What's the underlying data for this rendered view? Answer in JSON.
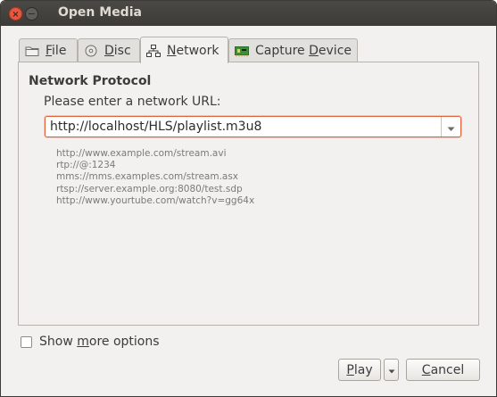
{
  "window": {
    "title": "Open Media"
  },
  "tabs": [
    {
      "label_pre": "",
      "label_ul": "F",
      "label_post": "ile",
      "icon": "folder-icon"
    },
    {
      "label_pre": "",
      "label_ul": "D",
      "label_post": "isc",
      "icon": "disc-icon"
    },
    {
      "label_pre": "",
      "label_ul": "N",
      "label_post": "etwork",
      "icon": "network-icon",
      "active": true
    },
    {
      "label_pre": "Capture ",
      "label_ul": "D",
      "label_post": "evice",
      "icon": "capture-card-icon"
    }
  ],
  "network": {
    "section_title": "Network Protocol",
    "prompt": "Please enter a network URL:",
    "url_value": "http://localhost/HLS/playlist.m3u8",
    "examples": [
      "http://www.example.com/stream.avi",
      "rtp://@:1234",
      "mms://mms.examples.com/stream.asx",
      "rtsp://server.example.org:8080/test.sdp",
      "http://www.yourtube.com/watch?v=gg64x"
    ]
  },
  "options": {
    "more_pre": "Show ",
    "more_ul": "m",
    "more_post": "ore options",
    "checked": false
  },
  "buttons": {
    "play_ul": "P",
    "play_post": "lay",
    "cancel_ul": "C",
    "cancel_post": "ancel"
  },
  "colors": {
    "focus_border": "#e0603a",
    "close_button": "#e8573f"
  }
}
